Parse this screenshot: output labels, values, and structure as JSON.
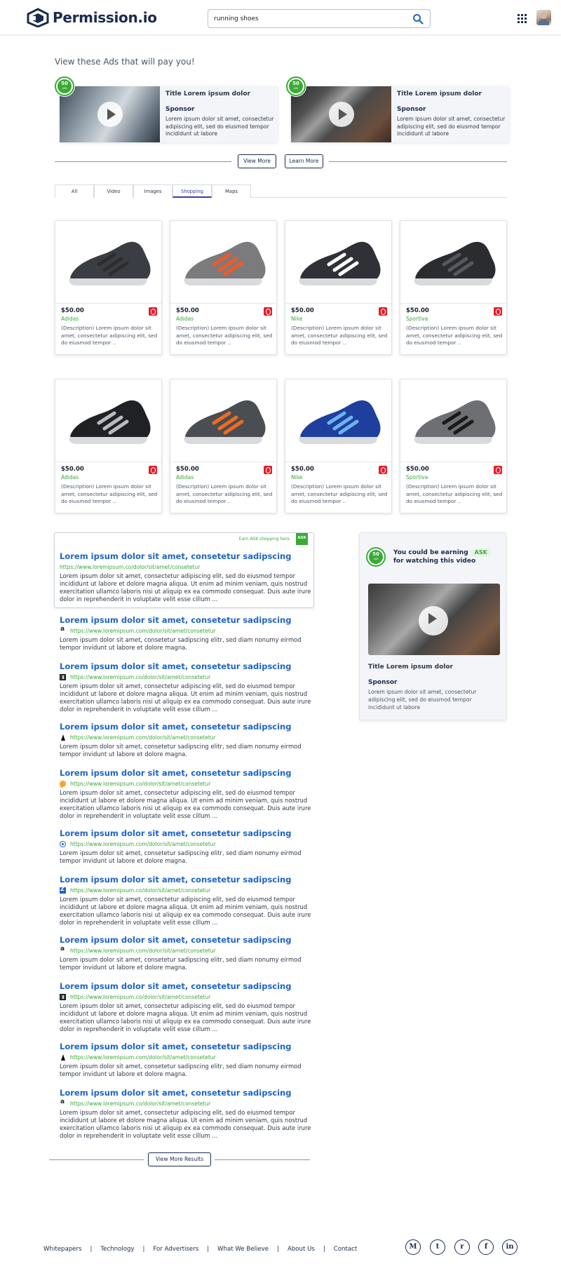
{
  "header": {
    "logo_text": "Permission.io",
    "search": {
      "value": "running shoes",
      "placeholder": ""
    }
  },
  "ads": {
    "heading": "View these Ads that will pay you!",
    "cards": [
      {
        "badge": "50",
        "badge_sub": "ASK",
        "title": "Title Lorem ipsum dolor",
        "sponsor": "Sponsor",
        "description": "Lorem ipsum dolor sit amet, consectetur adipiscing elit, sed do eiusmod tempor incididunt ut labore"
      },
      {
        "badge": "50",
        "badge_sub": "ASK",
        "title": "Title Lorem ipsum dolor",
        "sponsor": "Sponsor",
        "description": "Lorem ipsum dolor sit amet, consectetur adipiscing elit, sed do eiusmod tempor incididunt ut labore"
      }
    ],
    "view_more": "View More",
    "learn_more": "Learn More"
  },
  "tabs": [
    "All",
    "Video",
    "Images",
    "Shopping",
    "Maps"
  ],
  "active_tab": "Shopping",
  "products": [
    {
      "price": "$50.00",
      "brand": "Adidas",
      "description": "(Description) Lorem ipsum dolor sit amet, consectetur adipiscing elit, sed do eiusmod tempor ..",
      "shoe_color": "#3a3d42",
      "accent": "#2b2d31"
    },
    {
      "price": "$50.00",
      "brand": "Adidas",
      "description": "(Description) Lorem ipsum dolor sit amet, consectetur adipiscing elit, sed do eiusmod tempor ..",
      "shoe_color": "#7b7b7d",
      "accent": "#f05a28"
    },
    {
      "price": "$50.00",
      "brand": "Nike",
      "description": "(Description) Lorem ipsum dolor sit amet, consectetur adipiscing elit, sed do eiusmod tempor ..",
      "shoe_color": "#2f3136",
      "accent": "#ffffff"
    },
    {
      "price": "$50.00",
      "brand": "Sportiva",
      "description": "(Description) Lorem ipsum dolor sit amet, consectetur adipiscing elit, sed do eiusmod tempor ..",
      "shoe_color": "#2a2c30",
      "accent": "#55585e"
    },
    {
      "price": "$50.00",
      "brand": "Adidas",
      "description": "(Description) Lorem ipsum dolor sit amet, consectetur adipiscing elit, sed do eiusmod tempor ..",
      "shoe_color": "#1f2125",
      "accent": "#b8bcc2"
    },
    {
      "price": "$50.00",
      "brand": "Adidas",
      "description": "(Description) Lorem ipsum dolor sit amet, consectetur adipiscing elit, sed do eiusmod tempor ..",
      "shoe_color": "#4a4d52",
      "accent": "#f26a21"
    },
    {
      "price": "$50.00",
      "brand": "Nike",
      "description": "(Description) Lorem ipsum dolor sit amet, consectetur adipiscing elit, sed do eiusmod tempor ..",
      "shoe_color": "#1e3f9e",
      "accent": "#6ab3f0"
    },
    {
      "price": "$50.00",
      "brand": "Sportiva",
      "description": "(Description) Lorem ipsum dolor sit amet, consectetur adipiscing elit, sed do eiusmod tempor ..",
      "shoe_color": "#6d6f73",
      "accent": "#1a1a1a"
    }
  ],
  "featured_result": {
    "earn_label": "Earn ASK shopping here",
    "flag": "ASK",
    "title": "Lorem ipsum dolor sit amet, consetetur sadipscing",
    "url": "https://www.loremipsum.co/dolor/sit/amet/consetetur",
    "description": "Lorem ipsum dolor sit amet, consectetur adipiscing elit, sed do eiusmod tempor incididunt ut labore et dolore magna aliqua. Ut enim ad minim veniam, quis nostrud exercitation ullamco laboris nisi ut aliquip ex ea commodo consequat. Duis aute irure dolor in reprehenderit in voluptate velit esse cillum ..."
  },
  "results": [
    {
      "favicon": "amazon",
      "title": "Lorem ipsum dolor sit amet, consetetur sadipscing",
      "url": "https://www.loremipsum.com/dolor/sit/amet/consetetur",
      "description": "Lorem ipsum dolor sit amet, consetetur sadipscing elitr, sed diam nonumy eirmod tempor invidunt ut labore et dolore magna."
    },
    {
      "favicon": "book",
      "title": "Lorem ipsum dolor sit amet, consetetur sadipscing",
      "url": "https://www.loremipsum.co/dolor/sit/amet/consetetur",
      "description": "Lorem ipsum dolor sit amet, consectetur adipiscing elit, sed do eiusmod tempor incididunt ut labore et dolore magna aliqua. Ut enim ad minim veniam, quis nostrud exercitation ullamco laboris nisi ut aliquip ex ea commodo consequat. Duis aute irure dolor in reprehenderit in voluptate velit esse cillum ..."
    },
    {
      "favicon": "nike",
      "title": "Lorem ipsum dolor sit amet, consetetur sadipscing",
      "url": "https://www.loremipsum.com/dolor/sit/amet/consetetur",
      "description": "Lorem ipsum dolor sit amet, consetetur sadipscing elitr, sed diam nonumy eirmod tempor invidunt ut labore et dolore magna."
    },
    {
      "favicon": "orange",
      "title": "Lorem ipsum dolor sit amet, consetetur sadipscing",
      "url": "https://www.loremipsum.co/dolor/sit/amet/consetetur",
      "description": "Lorem ipsum dolor sit amet, consectetur adipiscing elit, sed do eiusmod tempor incididunt ut labore et dolore magna aliqua. Ut enim ad minim veniam, quis nostrud exercitation ullamco laboris nisi ut aliquip ex ea commodo consequat. Duis aute irure dolor in reprehenderit in voluptate velit esse cillum ..."
    },
    {
      "favicon": "eye",
      "title": "Lorem ipsum dolor sit amet, consetetur sadipscing",
      "url": "https://www.loremipsum.com/dolor/sit/amet/consetetur",
      "description": "Lorem ipsum dolor sit amet, consetetur sadipscing elitr, sed diam nonumy eirmod tempor invidunt ut labore et dolore magna."
    },
    {
      "favicon": "z",
      "title": "Lorem ipsum dolor sit amet, consetetur sadipscing",
      "url": "https://www.loremipsum.co/dolor/sit/amet/consetetur",
      "description": "Lorem ipsum dolor sit amet, consectetur adipiscing elit, sed do eiusmod tempor incididunt ut labore et dolore magna aliqua. Ut enim ad minim veniam, quis nostrud exercitation ullamco laboris nisi ut aliquip ex ea commodo consequat. Duis aute irure dolor in reprehenderit in voluptate velit esse cillum ..."
    },
    {
      "favicon": "amazon",
      "title": "Lorem ipsum dolor sit amet, consetetur sadipscing",
      "url": "https://www.loremipsum.com/dolor/sit/amet/consetetur",
      "description": "Lorem ipsum dolor sit amet, consetetur sadipscing elitr, sed diam nonumy eirmod tempor invidunt ut labore et dolore magna."
    },
    {
      "favicon": "book",
      "title": "Lorem ipsum dolor sit amet, consetetur sadipscing",
      "url": "https://www.loremipsum.co/dolor/sit/amet/consetetur",
      "description": "Lorem ipsum dolor sit amet, consectetur adipiscing elit, sed do eiusmod tempor incididunt ut labore et dolore magna aliqua. Ut enim ad minim veniam, quis nostrud exercitation ullamco laboris nisi ut aliquip ex ea commodo consequat. Duis aute irure dolor in reprehenderit in voluptate velit esse cillum ..."
    },
    {
      "favicon": "nike",
      "title": "Lorem ipsum dolor sit amet, consetetur sadipscing",
      "url": "https://www.loremipsum.com/dolor/sit/amet/consetetur",
      "description": "Lorem ipsum dolor sit amet, consetetur sadipscing elitr, sed diam nonumy eirmod tempor invidunt ut labore et dolore magna."
    },
    {
      "favicon": "amazon",
      "title": "Lorem ipsum dolor sit amet, consetetur sadipscing",
      "url": "https://www.loremipsum.co/dolor/sit/amet/consetetur",
      "description": "Lorem ipsum dolor sit amet, consectetur adipiscing elit, sed do eiusmod tempor incididunt ut labore et dolore magna aliqua. Ut enim ad minim veniam, quis nostrud exercitation ullamco laboris nisi ut aliquip ex ea commodo consequat. Duis aute irure dolor in reprehenderit in voluptate velit esse cillum ..."
    }
  ],
  "view_more_results": "View More Results",
  "side_ad": {
    "badge": "50",
    "badge_sub": "ASK",
    "earn_prefix": "You could be earning",
    "earn_token": "ASK",
    "earn_suffix": "for watching this video",
    "title": "Title Lorem ipsum dolor",
    "sponsor": "Sponsor",
    "description": "Lorem ipsum dolor sit amet, consectetur adipiscing elit, sed do eiusmod tempor incididunt ut labore"
  },
  "footer": {
    "links": [
      "Whitepapers",
      "Technology",
      "For Advertisers",
      "What We Believe",
      "About Us",
      "Contact"
    ],
    "social": [
      "medium-icon",
      "twitter-icon",
      "reddit-icon",
      "facebook-icon",
      "linkedin-icon"
    ],
    "social_glyphs": [
      "M",
      "t",
      "r",
      "f",
      "in"
    ]
  },
  "colors": {
    "brand_navy": "#1b2a4e",
    "ask_green": "#3aaa35",
    "link_blue": "#1d64c8",
    "store_red": "#e41e2b"
  }
}
